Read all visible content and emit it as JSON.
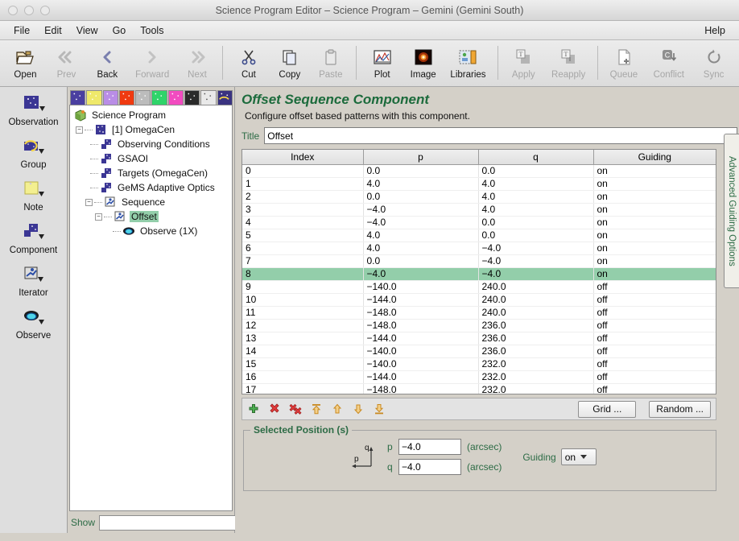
{
  "window": {
    "title": "Science Program Editor – Science Program – Gemini (Gemini South)"
  },
  "menubar": {
    "items": [
      "File",
      "Edit",
      "View",
      "Go",
      "Tools"
    ],
    "help": "Help"
  },
  "toolbar": {
    "buttons": [
      {
        "label": "Open",
        "icon": "open-folder-icon",
        "enabled": true
      },
      {
        "label": "Prev",
        "icon": "prev-icon",
        "enabled": false
      },
      {
        "label": "Back",
        "icon": "back-icon",
        "enabled": true
      },
      {
        "label": "Forward",
        "icon": "forward-icon",
        "enabled": false
      },
      {
        "label": "Next",
        "icon": "next-icon",
        "enabled": false
      },
      {
        "label": "Cut",
        "icon": "scissors-icon",
        "enabled": true
      },
      {
        "label": "Copy",
        "icon": "copy-icon",
        "enabled": true
      },
      {
        "label": "Paste",
        "icon": "paste-icon",
        "enabled": false
      },
      {
        "label": "Plot",
        "icon": "plot-icon",
        "enabled": true
      },
      {
        "label": "Image",
        "icon": "image-icon",
        "enabled": true
      },
      {
        "label": "Libraries",
        "icon": "libraries-icon",
        "enabled": true
      },
      {
        "label": "Apply",
        "icon": "apply-icon",
        "enabled": false
      },
      {
        "label": "Reapply",
        "icon": "reapply-icon",
        "enabled": false
      },
      {
        "label": "Queue",
        "icon": "queue-icon",
        "enabled": false
      },
      {
        "label": "Conflict",
        "icon": "conflict-icon",
        "enabled": false
      },
      {
        "label": "Sync",
        "icon": "sync-icon",
        "enabled": false
      }
    ]
  },
  "palette": {
    "items": [
      {
        "label": "Observation",
        "icon": "observation-icon"
      },
      {
        "label": "Group",
        "icon": "group-icon"
      },
      {
        "label": "Note",
        "icon": "note-icon"
      },
      {
        "label": "Component",
        "icon": "component-icon"
      },
      {
        "label": "Iterator",
        "icon": "iterator-icon"
      },
      {
        "label": "Observe",
        "icon": "observe-icon"
      }
    ]
  },
  "tree": {
    "color_tabs": [
      "#4a3fa0",
      "#efe96a",
      "#b98de6",
      "#f03a10",
      "#b9b9b9",
      "#2fd46a",
      "#f24bc0",
      "#2a2a2a",
      "#e9e9e9",
      "#3a3380"
    ],
    "nodes": [
      {
        "label": "Science Program",
        "indent": 0,
        "icon": "program-icon",
        "expander": "",
        "selected": false
      },
      {
        "label": "[1] OmegaCen",
        "indent": 1,
        "icon": "observation-icon",
        "expander": "-",
        "selected": false
      },
      {
        "label": "Observing Conditions",
        "indent": 2,
        "icon": "component-icon",
        "expander": "",
        "selected": false
      },
      {
        "label": "GSAOI",
        "indent": 2,
        "icon": "component-icon",
        "expander": "",
        "selected": false
      },
      {
        "label": "Targets (OmegaCen)",
        "indent": 2,
        "icon": "component-icon",
        "expander": "",
        "selected": false
      },
      {
        "label": "GeMS Adaptive Optics",
        "indent": 2,
        "icon": "component-icon",
        "expander": "",
        "selected": false
      },
      {
        "label": "Sequence",
        "indent": 2,
        "icon": "iterator-icon",
        "expander": "-",
        "selected": false
      },
      {
        "label": "Offset",
        "indent": 3,
        "icon": "iterator-icon",
        "expander": "-",
        "selected": true
      },
      {
        "label": "Observe (1X)",
        "indent": 4,
        "icon": "observe-icon",
        "expander": "",
        "selected": false
      }
    ],
    "show_label": "Show",
    "show_value": ""
  },
  "editor": {
    "heading": "Offset Sequence Component",
    "subheading": "Configure offset based patterns with this component.",
    "title_label": "Title",
    "title_value": "Offset",
    "vertical_tab": "Advanced Guiding Options"
  },
  "table": {
    "columns": [
      "Index",
      "p",
      "q",
      "Guiding"
    ],
    "selected_index": 8,
    "rows": [
      {
        "index": "0",
        "p": "0.0",
        "q": "0.0",
        "guiding": "on"
      },
      {
        "index": "1",
        "p": "4.0",
        "q": "4.0",
        "guiding": "on"
      },
      {
        "index": "2",
        "p": "0.0",
        "q": "4.0",
        "guiding": "on"
      },
      {
        "index": "3",
        "p": "−4.0",
        "q": "4.0",
        "guiding": "on"
      },
      {
        "index": "4",
        "p": "−4.0",
        "q": "0.0",
        "guiding": "on"
      },
      {
        "index": "5",
        "p": "4.0",
        "q": "0.0",
        "guiding": "on"
      },
      {
        "index": "6",
        "p": "4.0",
        "q": "−4.0",
        "guiding": "on"
      },
      {
        "index": "7",
        "p": "0.0",
        "q": "−4.0",
        "guiding": "on"
      },
      {
        "index": "8",
        "p": "−4.0",
        "q": "−4.0",
        "guiding": "on"
      },
      {
        "index": "9",
        "p": "−140.0",
        "q": "240.0",
        "guiding": "off"
      },
      {
        "index": "10",
        "p": "−144.0",
        "q": "240.0",
        "guiding": "off"
      },
      {
        "index": "11",
        "p": "−148.0",
        "q": "240.0",
        "guiding": "off"
      },
      {
        "index": "12",
        "p": "−148.0",
        "q": "236.0",
        "guiding": "off"
      },
      {
        "index": "13",
        "p": "−144.0",
        "q": "236.0",
        "guiding": "off"
      },
      {
        "index": "14",
        "p": "−140.0",
        "q": "236.0",
        "guiding": "off"
      },
      {
        "index": "15",
        "p": "−140.0",
        "q": "232.0",
        "guiding": "off"
      },
      {
        "index": "16",
        "p": "−144.0",
        "q": "232.0",
        "guiding": "off"
      },
      {
        "index": "17",
        "p": "−148.0",
        "q": "232.0",
        "guiding": "off"
      }
    ]
  },
  "table_tools": {
    "icons": [
      {
        "name": "add-position-icon"
      },
      {
        "name": "remove-position-icon"
      },
      {
        "name": "remove-all-positions-icon"
      },
      {
        "name": "move-to-top-icon"
      },
      {
        "name": "move-up-icon"
      },
      {
        "name": "move-down-icon"
      },
      {
        "name": "move-to-bottom-icon"
      }
    ],
    "grid_button": "Grid ...",
    "random_button": "Random ..."
  },
  "selected_position": {
    "legend": "Selected Position (s)",
    "p_label": "p",
    "p_value": "−4.0",
    "p_units": "(arcsec)",
    "q_label": "q",
    "q_value": "−4.0",
    "q_units": "(arcsec)",
    "guiding_label": "Guiding",
    "guiding_value": "on",
    "axis_p": "p",
    "axis_q": "q"
  },
  "colors": {
    "accent_green": "#1c6b3c",
    "label_green": "#2c6b45",
    "selection_green": "#93ceaa",
    "window_bg": "#d4d0c8"
  }
}
